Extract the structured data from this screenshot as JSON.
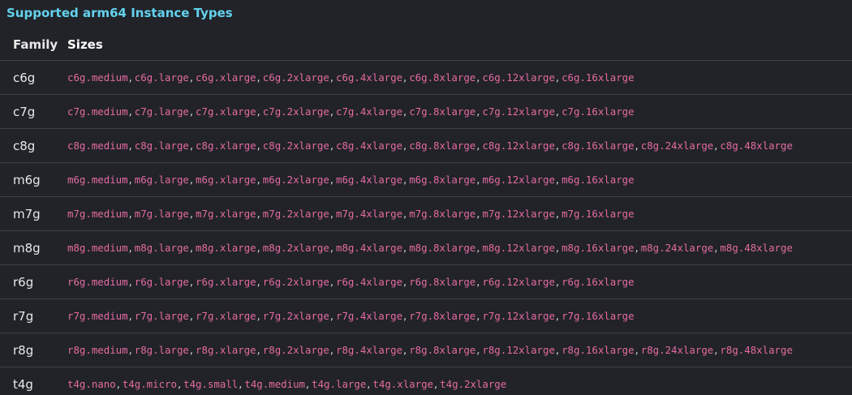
{
  "heading": {
    "prefix": "Supported ",
    "code": "arm64",
    "suffix": " Instance Types"
  },
  "table": {
    "headers": {
      "family": "Family",
      "sizes": "Sizes"
    },
    "rows": [
      {
        "family": "c6g",
        "sizes": [
          "c6g.medium",
          "c6g.large",
          "c6g.xlarge",
          "c6g.2xlarge",
          "c6g.4xlarge",
          "c6g.8xlarge",
          "c6g.12xlarge",
          "c6g.16xlarge"
        ]
      },
      {
        "family": "c7g",
        "sizes": [
          "c7g.medium",
          "c7g.large",
          "c7g.xlarge",
          "c7g.2xlarge",
          "c7g.4xlarge",
          "c7g.8xlarge",
          "c7g.12xlarge",
          "c7g.16xlarge"
        ]
      },
      {
        "family": "c8g",
        "sizes": [
          "c8g.medium",
          "c8g.large",
          "c8g.xlarge",
          "c8g.2xlarge",
          "c8g.4xlarge",
          "c8g.8xlarge",
          "c8g.12xlarge",
          "c8g.16xlarge",
          "c8g.24xlarge",
          "c8g.48xlarge"
        ]
      },
      {
        "family": "m6g",
        "sizes": [
          "m6g.medium",
          "m6g.large",
          "m6g.xlarge",
          "m6g.2xlarge",
          "m6g.4xlarge",
          "m6g.8xlarge",
          "m6g.12xlarge",
          "m6g.16xlarge"
        ]
      },
      {
        "family": "m7g",
        "sizes": [
          "m7g.medium",
          "m7g.large",
          "m7g.xlarge",
          "m7g.2xlarge",
          "m7g.4xlarge",
          "m7g.8xlarge",
          "m7g.12xlarge",
          "m7g.16xlarge"
        ]
      },
      {
        "family": "m8g",
        "sizes": [
          "m8g.medium",
          "m8g.large",
          "m8g.xlarge",
          "m8g.2xlarge",
          "m8g.4xlarge",
          "m8g.8xlarge",
          "m8g.12xlarge",
          "m8g.16xlarge",
          "m8g.24xlarge",
          "m8g.48xlarge"
        ]
      },
      {
        "family": "r6g",
        "sizes": [
          "r6g.medium",
          "r6g.large",
          "r6g.xlarge",
          "r6g.2xlarge",
          "r6g.4xlarge",
          "r6g.8xlarge",
          "r6g.12xlarge",
          "r6g.16xlarge"
        ]
      },
      {
        "family": "r7g",
        "sizes": [
          "r7g.medium",
          "r7g.large",
          "r7g.xlarge",
          "r7g.2xlarge",
          "r7g.4xlarge",
          "r7g.8xlarge",
          "r7g.12xlarge",
          "r7g.16xlarge"
        ]
      },
      {
        "family": "r8g",
        "sizes": [
          "r8g.medium",
          "r8g.large",
          "r8g.xlarge",
          "r8g.2xlarge",
          "r8g.4xlarge",
          "r8g.8xlarge",
          "r8g.12xlarge",
          "r8g.16xlarge",
          "r8g.24xlarge",
          "r8g.48xlarge"
        ]
      },
      {
        "family": "t4g",
        "sizes": [
          "t4g.nano",
          "t4g.micro",
          "t4g.small",
          "t4g.medium",
          "t4g.large",
          "t4g.xlarge",
          "t4g.2xlarge"
        ]
      }
    ],
    "separator": ","
  },
  "colors": {
    "background": "#212328",
    "heading": "#63d2ee",
    "code": "#e56ba1",
    "divider": "#3c4047",
    "text": "#e8e8e8"
  }
}
